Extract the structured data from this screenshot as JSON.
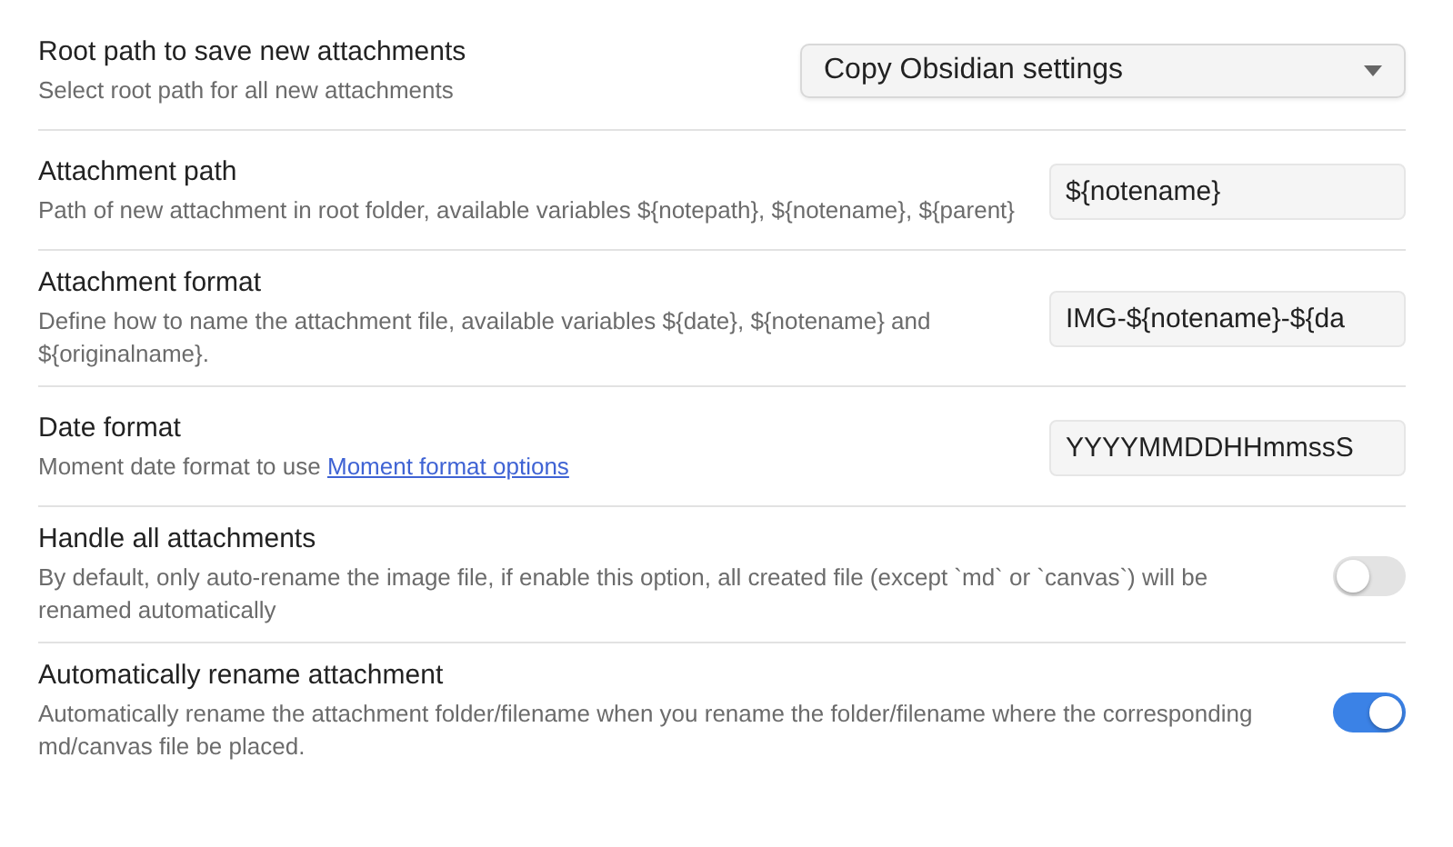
{
  "settings": [
    {
      "kind": "dropdown",
      "title": "Root path to save new attachments",
      "description": "Select root path for all new attachments",
      "value": "Copy Obsidian settings"
    },
    {
      "kind": "text",
      "title": "Attachment path",
      "description": "Path of new attachment in root folder, available variables ${notepath}, ${notename}, ${parent}",
      "value": "${notename}"
    },
    {
      "kind": "text",
      "title": "Attachment format",
      "description": "Define how to name the attachment file, available variables ${date}, ${notename} and ${originalname}.",
      "value": "IMG-${notename}-${da"
    },
    {
      "kind": "text",
      "title": "Date format",
      "description": "Moment date format to use",
      "link": "Moment format options",
      "value": "YYYYMMDDHHmmssS"
    },
    {
      "kind": "toggle",
      "title": "Handle all attachments",
      "description": "By default, only auto-rename the image file, if enable this option, all created file (except `md` or `canvas`) will be renamed automatically",
      "on": false
    },
    {
      "kind": "toggle",
      "title": "Automatically rename attachment",
      "description": "Automatically rename the attachment folder/filename when you rename the folder/filename where the corresponding md/canvas file be placed.",
      "on": true
    }
  ]
}
